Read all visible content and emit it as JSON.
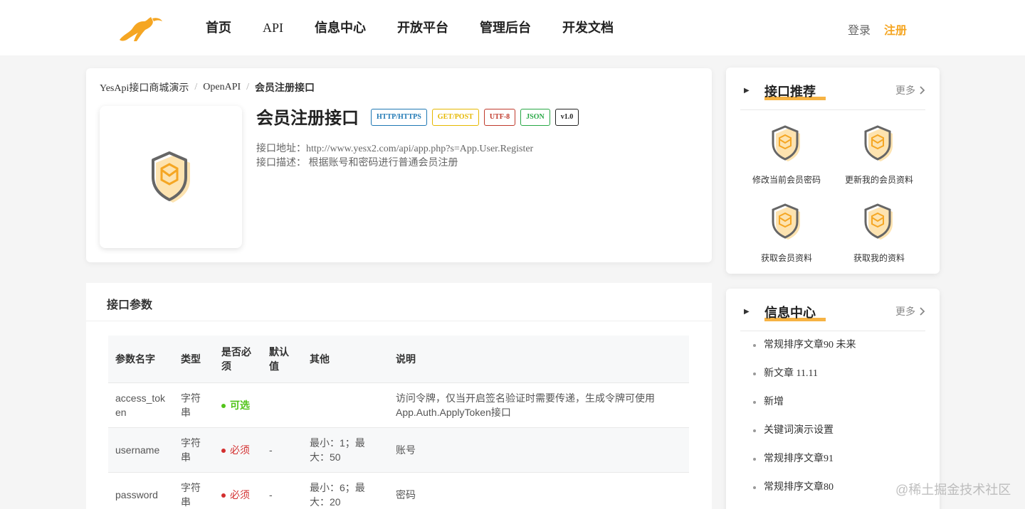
{
  "nav": {
    "items": [
      "首页",
      "API",
      "信息中心",
      "开放平台",
      "管理后台",
      "开发文档"
    ],
    "login": "登录",
    "register": "注册"
  },
  "breadcrumb": {
    "b1": "YesApi接口商城演示",
    "b2": "OpenAPI",
    "b3": "会员注册接口"
  },
  "api": {
    "title": "会员注册接口",
    "tags": [
      "HTTP/HTTPS",
      "GET/POST",
      "UTF-8",
      "JSON",
      "v1.0"
    ],
    "url_label": "接口地址：",
    "url": "http://www.yesx2.com/api/app.php?s=App.User.Register",
    "desc_label": "接口描述：",
    "desc": "根据账号和密码进行普通会员注册"
  },
  "params": {
    "title": "接口参数",
    "headers": [
      "参数名字",
      "类型",
      "是否必须",
      "默认值",
      "其他",
      "说明"
    ],
    "rows": [
      {
        "name": "access_token",
        "type": "字符串",
        "required": "可选",
        "default": "",
        "other": "",
        "desc": "访问令牌，仅当开启签名验证时需要传递，生成令牌可使用App.Auth.ApplyToken接口"
      },
      {
        "name": "username",
        "type": "字符串",
        "required": "必须",
        "default": "-",
        "other": "最小：1；最大：50",
        "desc": "账号"
      },
      {
        "name": "password",
        "type": "字符串",
        "required": "必须",
        "default": "-",
        "other": "最小：6；最大：20",
        "desc": "密码"
      }
    ],
    "colors": {
      "optional": "#52c41a",
      "required": "#d32f2f"
    }
  },
  "recommend": {
    "title": "接口推荐",
    "more": "更多",
    "items": [
      "修改当前会员密码",
      "更新我的会员资料",
      "获取会员资料",
      "获取我的资料"
    ]
  },
  "newsbox": {
    "title": "信息中心",
    "more": "更多",
    "items": [
      "常规排序文章90 未来",
      "新文章 11.11",
      "新增",
      "关键词演示设置",
      "常规排序文章91",
      "常规排序文章80"
    ]
  },
  "watermark": "@稀土掘金技术社区",
  "theme": {
    "accent": "#f5a623"
  }
}
